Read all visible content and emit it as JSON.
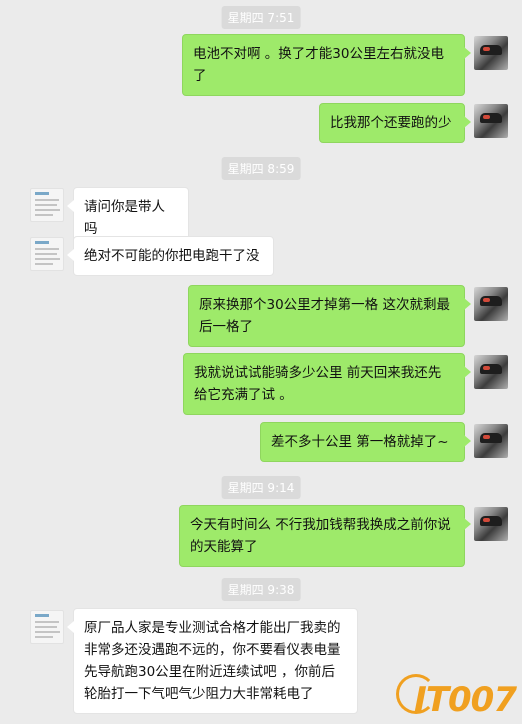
{
  "times": [
    "星期四 7:51",
    "星期四 8:59",
    "星期四 9:14",
    "星期四 9:38"
  ],
  "messages": [
    {
      "from": "me",
      "text": "电池不对啊 。换了才能30公里左右就没电了"
    },
    {
      "from": "me",
      "text": "比我那个还要跑的少"
    },
    {
      "from": "other",
      "text": "请问你是带人吗"
    },
    {
      "from": "other",
      "text": "绝对不可能的你把电跑干了没"
    },
    {
      "from": "me",
      "text": "原来换那个30公里才掉第一格    这次就剩最后一格了"
    },
    {
      "from": "me",
      "text": "我就说试试能骑多少公里  前天回来我还先给它充满了试 。"
    },
    {
      "from": "me",
      "text": "差不多十公里 第一格就掉了~"
    },
    {
      "from": "me",
      "text": "今天有时间么   不行我加钱帮我换成之前你说的天能算了"
    },
    {
      "from": "other",
      "text": "原厂品人家是专业测试合格才能出厂我卖的非常多还没遇跑不远的，你不要看仪表电量先导航跑30公里在附近连续试吧 ，你前后轮胎打一下气吧气少阻力大非常耗电了"
    }
  ],
  "watermark": "IT007",
  "colors": {
    "my_bubble": "#9eea6a",
    "their_bubble": "#ffffff",
    "background": "#ebebeb"
  }
}
